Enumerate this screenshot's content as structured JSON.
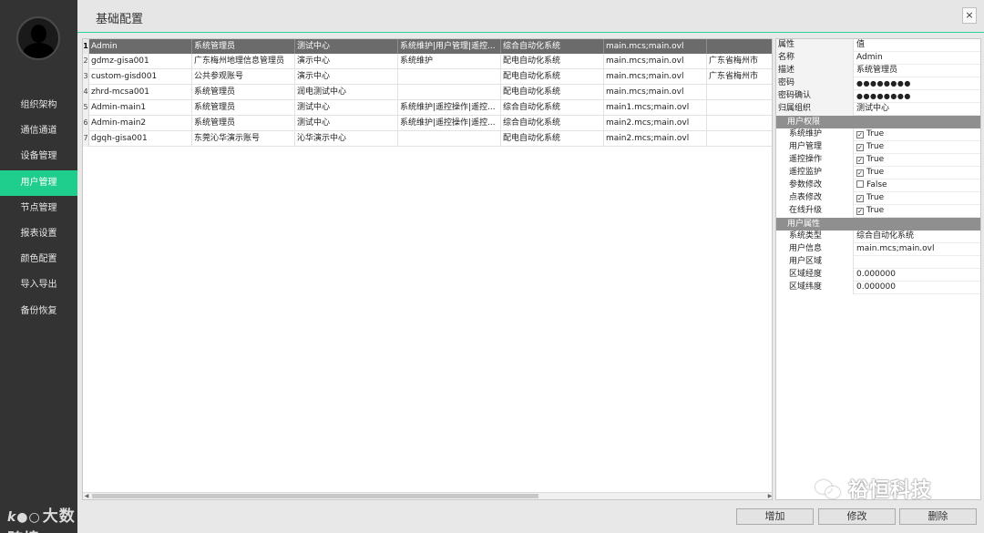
{
  "header": {
    "title": "基础配置",
    "close_label": "×"
  },
  "sidebar": {
    "items": [
      {
        "label": "组织架构",
        "active": false
      },
      {
        "label": "通信通道",
        "active": false
      },
      {
        "label": "设备管理",
        "active": false
      },
      {
        "label": "用户管理",
        "active": true
      },
      {
        "label": "节点管理",
        "active": false
      },
      {
        "label": "报表设置",
        "active": false
      },
      {
        "label": "颜色配置",
        "active": false
      },
      {
        "label": "导入导出",
        "active": false
      },
      {
        "label": "备份恢复",
        "active": false
      }
    ]
  },
  "watermarks": {
    "left": "大数跨境",
    "right": "裕恒科技"
  },
  "colors": {
    "accent": "#1fce8d",
    "sidebar_bg": "#333333",
    "table_header_bg": "#6b6b6b",
    "section_bg": "#8f8f8f"
  },
  "table": {
    "rows": [
      {
        "num": "1",
        "cells": [
          "Admin",
          "系统管理员",
          "测试中心",
          "系统维护|用户管理|遥控...",
          "综合自动化系统",
          "main.mcs;main.ovl",
          ""
        ]
      },
      {
        "num": "2",
        "cells": [
          "gdmz-gisa001",
          "广东梅州地理信息管理员",
          "演示中心",
          "系统维护",
          "配电自动化系统",
          "main.mcs;main.ovl",
          "广东省梅州市"
        ]
      },
      {
        "num": "3",
        "cells": [
          "custom-gisd001",
          "公共参观账号",
          "演示中心",
          "",
          "配电自动化系统",
          "main.mcs;main.ovl",
          "广东省梅州市"
        ]
      },
      {
        "num": "4",
        "cells": [
          "zhrd-mcsa001",
          "系统管理员",
          "润电测试中心",
          "",
          "配电自动化系统",
          "main.mcs;main.ovl",
          ""
        ]
      },
      {
        "num": "5",
        "cells": [
          "Admin-main1",
          "系统管理员",
          "测试中心",
          "系统维护|遥控操作|遥控...",
          "综合自动化系统",
          "main1.mcs;main.ovl",
          ""
        ]
      },
      {
        "num": "6",
        "cells": [
          "Admin-main2",
          "系统管理员",
          "测试中心",
          "系统维护|遥控操作|遥控...",
          "综合自动化系统",
          "main2.mcs;main.ovl",
          ""
        ]
      },
      {
        "num": "7",
        "cells": [
          "dgqh-gisa001",
          "东莞沁华演示账号",
          "沁华演示中心",
          "",
          "配电自动化系统",
          "main2.mcs;main.ovl",
          ""
        ]
      }
    ]
  },
  "properties": {
    "header": {
      "key": "属性",
      "value": "值"
    },
    "basic": [
      {
        "key": "名称",
        "value": "Admin"
      },
      {
        "key": "描述",
        "value": "系统管理员"
      },
      {
        "key": "密码",
        "value": "●●●●●●●●"
      },
      {
        "key": "密码确认",
        "value": "●●●●●●●●"
      },
      {
        "key": "归属组织",
        "value": "测试中心"
      }
    ],
    "permissions_title": "用户权限",
    "permissions": [
      {
        "key": "系统维护",
        "value": "True",
        "checked": true
      },
      {
        "key": "用户管理",
        "value": "True",
        "checked": true
      },
      {
        "key": "遥控操作",
        "value": "True",
        "checked": true
      },
      {
        "key": "遥控监护",
        "value": "True",
        "checked": true
      },
      {
        "key": "参数修改",
        "value": "False",
        "checked": false
      },
      {
        "key": "点表修改",
        "value": "True",
        "checked": true
      },
      {
        "key": "在线升级",
        "value": "True",
        "checked": true
      }
    ],
    "attributes_title": "用户属性",
    "attributes": [
      {
        "key": "系统类型",
        "value": "综合自动化系统"
      },
      {
        "key": "用户信息",
        "value": "main.mcs;main.ovl"
      },
      {
        "key": "用户区域",
        "value": ""
      },
      {
        "key": "区域经度",
        "value": "0.000000"
      },
      {
        "key": "区域纬度",
        "value": "0.000000"
      }
    ]
  },
  "buttons": {
    "add": "增加",
    "edit": "修改",
    "delete": "删除"
  }
}
